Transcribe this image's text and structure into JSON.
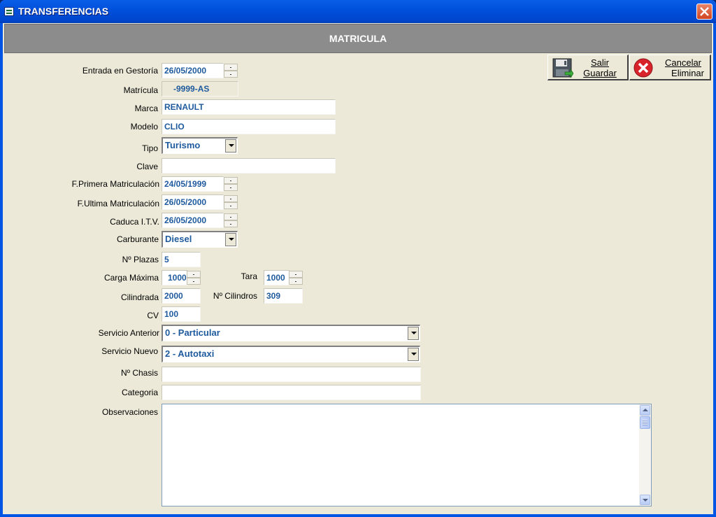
{
  "window": {
    "title": "TRANSFERENCIAS",
    "header": "MATRICULA"
  },
  "toolbar": {
    "save_top": "Salir",
    "save_bottom": "Guardar",
    "cancel_top": "Cancelar",
    "cancel_bottom": "Eliminar"
  },
  "form": {
    "entrada_label": "Entrada en Gestoría",
    "entrada_value": "26/05/2000",
    "matricula_label": "Matrícula",
    "matricula_value": "-9999-AS",
    "marca_label": "Marca",
    "marca_value": "RENAULT",
    "modelo_label": "Modelo",
    "modelo_value": "CLIO",
    "tipo_label": "Tipo",
    "tipo_value": "Turismo",
    "clave_label": "Clave",
    "clave_value": "",
    "fprimera_label": "F.Primera Matriculación",
    "fprimera_value": "24/05/1999",
    "fultima_label": "F.Ultima Matriculación",
    "fultima_value": "26/05/2000",
    "itv_label": "Caduca I.T.V.",
    "itv_value": "26/05/2000",
    "carburante_label": "Carburante",
    "carburante_value": "Diesel",
    "plazas_label": "Nº Plazas",
    "plazas_value": "5",
    "carga_label": "Carga Máxima",
    "carga_value": "1000",
    "tara_label": "Tara",
    "tara_value": "1000",
    "cilindrada_label": "Cilindrada",
    "cilindrada_value": "2000",
    "ncilindros_label": "Nº Cilindros",
    "ncilindros_value": "309",
    "cv_label": "CV",
    "cv_value": "100",
    "servicio_anterior_label": "Servicio Anterior",
    "servicio_anterior_value": "0 - Particular",
    "servicio_nuevo_label": "Servicio Nuevo",
    "servicio_nuevo_value": "2 - Autotaxi",
    "chasis_label": "Nº Chasis",
    "chasis_value": "",
    "categoria_label": "Categoria",
    "categoria_value": "",
    "observaciones_label": "Observaciones",
    "observaciones_value": ""
  }
}
